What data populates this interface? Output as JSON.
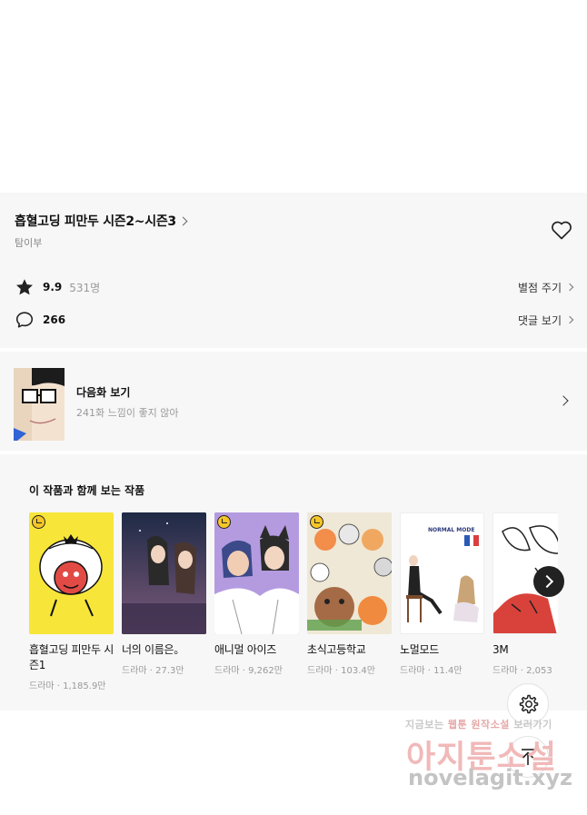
{
  "work": {
    "title": "흡혈고딩 피만두 시즌2~시즌3",
    "author": "탐이부",
    "rating": "9.9",
    "rating_count": "531명",
    "rate_link": "별점 주기",
    "comment_count": "266",
    "comment_link": "댓글 보기"
  },
  "next_episode": {
    "title": "다음화 보기",
    "subtitle": "241화 느낌이 좋지 않아"
  },
  "recommend": {
    "section_title": "이 작품과 함께 보는 작품",
    "items": [
      {
        "title": "흡혈고딩 피만두 시즌1",
        "meta": "드라마 · 1,185.9만",
        "clock": true
      },
      {
        "title": "너의 이름은。",
        "meta": "드라마 · 27.3만",
        "clock": false
      },
      {
        "title": "애니멀 아이즈",
        "meta": "드라마 · 9,262만",
        "clock": true
      },
      {
        "title": "초식고등학교",
        "meta": "드라마 · 103.4만",
        "clock": true
      },
      {
        "title": "노멀모드",
        "meta": "드라마 · 11.4만",
        "clock": false
      },
      {
        "title": "3M",
        "meta": "드라마 · 2,053",
        "clock": false
      }
    ],
    "cover_texts": {
      "normal_mode": "NORMAL MODE"
    }
  },
  "watermark": {
    "line1_a": "지금보는",
    "line1_b": "웹툰",
    "line1_c": "원작소설",
    "line1_d": "보러가기",
    "line2": "아지툰소설",
    "line3": "novelagit.xyz"
  },
  "colors": {
    "panel_bg": "#f7f7f7",
    "accent_yellow": "#f6c628",
    "watermark_pink": "#f1b9b9"
  }
}
